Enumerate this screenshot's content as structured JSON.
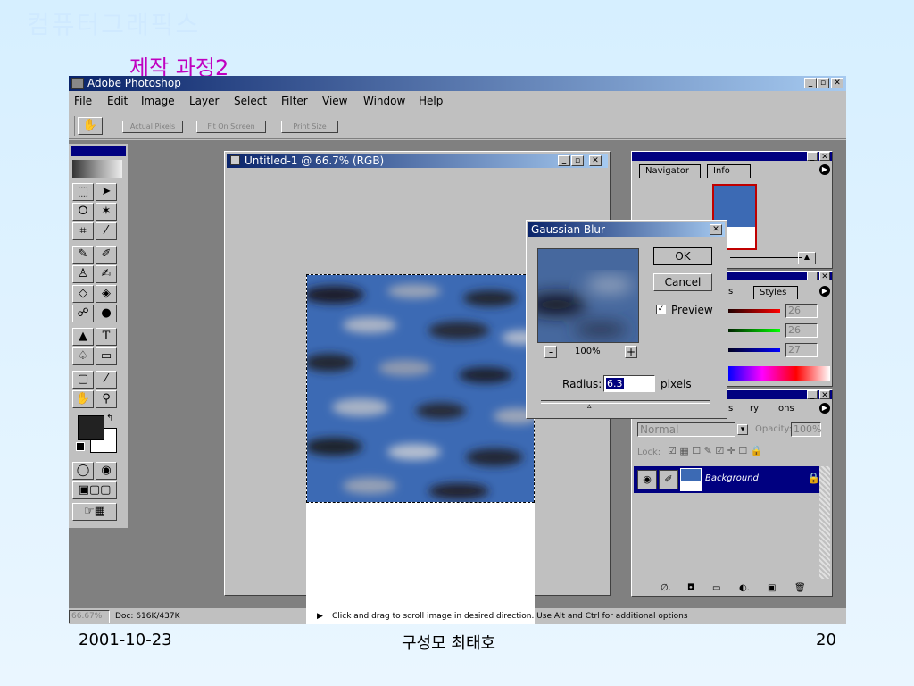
{
  "slide": {
    "title": "컴퓨터그래픽스",
    "subtitle": "제작 과정2",
    "footer_date": "2001-10-23",
    "footer_author": "구성모 최태호",
    "footer_page": "20"
  },
  "app": {
    "title": "Adobe Photoshop",
    "window_controls": [
      "_",
      "▫",
      "✕"
    ],
    "menu": [
      "File",
      "Edit",
      "Image",
      "Layer",
      "Select",
      "Filter",
      "View",
      "Window",
      "Help"
    ],
    "options_buttons": [
      "Actual Pixels",
      "Fit On Screen",
      "Print Size"
    ]
  },
  "document": {
    "title": "Untitled-1 @ 66.7% (RGB)"
  },
  "gaussian_blur": {
    "title": "Gaussian Blur",
    "ok_label": "OK",
    "cancel_label": "Cancel",
    "preview_label": "Preview",
    "preview_checked": true,
    "zoom_minus": "-",
    "zoom_plus": "+",
    "zoom": "100%",
    "radius_label": "Radius:",
    "radius_value": "6.3",
    "radius_unit": "pixels"
  },
  "navigator": {
    "tabs": [
      "Navigator",
      "Info"
    ]
  },
  "color_panel": {
    "tab_fragment": "s",
    "styles_tab": "Styles",
    "values": [
      "26",
      "26",
      "27"
    ]
  },
  "layers_panel": {
    "tabs": [
      "s",
      "ry",
      "ons"
    ],
    "blend_mode": "Normal",
    "opacity_label": "Opacity:",
    "opacity_value": "100%",
    "lock_label": "Lock:",
    "layer_name": "Background"
  },
  "status": {
    "zoom": "66.67%",
    "doc": "Doc: 616K/437K",
    "hint": "Click and drag to scroll image in desired direction.  Use Alt and Ctrl for additional options"
  },
  "colors": {
    "title_bar_start": "#0a246a",
    "title_bar_end": "#a6caf0",
    "chrome": "#c0c0c0",
    "texture_blue": "#3c6ab4",
    "subtitle": "#c000c0"
  }
}
